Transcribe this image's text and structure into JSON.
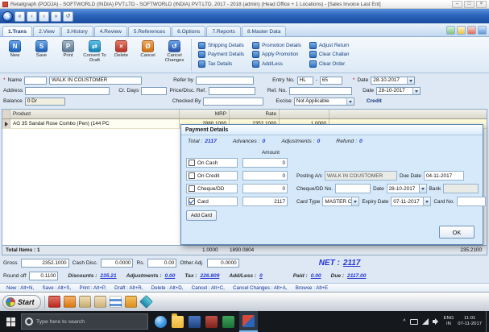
{
  "window": {
    "title": "Retailgraph (POOJA) - SOFTWORLD (INDIA) PVT.LTD - SOFTWORLD (INDIA) PVT.LTD.  2017 - 2018 (admin) (Head Office + 1 Locations) - [Sales Invoice   Last Ent]",
    "controls": {
      "minimize": "–",
      "maximize": "□",
      "close": "×"
    }
  },
  "toolbar": {
    "logo": "S",
    "nav": [
      "«",
      "‹",
      "›",
      "»",
      "↺"
    ]
  },
  "tabs": [
    "1.Trans",
    "2.View",
    "3.History",
    "4.Review",
    "5.References",
    "6.Options",
    "7.Reports",
    "8.Master Data"
  ],
  "ribbon": {
    "main": [
      {
        "glyph": "N",
        "label": "New"
      },
      {
        "glyph": "S",
        "label": "Save"
      },
      {
        "glyph": "P",
        "label": "Print"
      },
      {
        "glyph": "⇄",
        "label": "Convert To Draft"
      },
      {
        "glyph": "×",
        "label": "Delete"
      },
      {
        "glyph": "Ø",
        "label": "Cancel"
      },
      {
        "glyph": "↺",
        "label": "Cancel Changes"
      }
    ],
    "details": [
      "Shipping Details",
      "Payment Details",
      "Tax Details",
      "Promotion Details",
      "Apply Promotion",
      "Add/Less",
      "Adjust Return",
      "Clear Challan",
      "Clear Order"
    ]
  },
  "form": {
    "req_mark": "*",
    "name_label": "Name",
    "name_value": "WALK IN COUSTOMER",
    "refer_by_label": "Refer by",
    "entry_no_label": "Entry No.",
    "entry_prefix": "HL",
    "entry_sep": "-",
    "entry_number": "65",
    "date1_label": "Date",
    "date1_value": "28-10-2017",
    "address_label": "Address",
    "cr_days_label": "Cr. Days",
    "price_ref_label": "Price/Disc. Ref.",
    "ref_no_label": "Ref. No.",
    "date2_label": "Date",
    "date2_value": "28-10-2017",
    "balance_label": "Balance",
    "balance_value": "0 Dr",
    "checked_by_label": "Checked By",
    "excise_label": "Excise",
    "excise_value": "Not Applicable",
    "credit_label": "Credit"
  },
  "grid": {
    "columns": [
      "Product",
      "MRP",
      "Rate"
    ],
    "row": {
      "product": "AG 35 Sandal Rose Combo (Pen) (144 PC",
      "mrp": "2880.1000",
      "rate": "2352.1000",
      "qty": "1.0000"
    },
    "totals": {
      "label": "Total Items : 1",
      "qty": "1.0000",
      "amount": "1890.0804",
      "discount": "235.2100"
    }
  },
  "payment": {
    "title": "Payment Details",
    "totals": [
      {
        "label": "Total :",
        "value": "2117"
      },
      {
        "label": "Advances :",
        "value": "0"
      },
      {
        "label": "Adjustments :",
        "value": "0"
      },
      {
        "label": "Refund :",
        "value": "0"
      }
    ],
    "amount_header": "Amount",
    "cash": {
      "label": "On Cash",
      "amount": "0"
    },
    "credit": {
      "label": "On Credit",
      "amount": "0",
      "posting_label": "Posting A/c",
      "posting_value": "WALK IN COUSTOMER",
      "due_label": "Due Date",
      "due_value": "04-11-2017"
    },
    "cheque": {
      "label": "Cheque/DD",
      "amount": "0",
      "no_label": "Cheque/DD No.",
      "no_value": "",
      "date_label": "Date",
      "date_value": "28-10-2017",
      "bank_label": "Bank",
      "bank_value": ""
    },
    "card": {
      "label": "Card",
      "amount": "2117",
      "type_label": "Card Type",
      "type_value": "MASTER CAR",
      "expiry_label": "Expiry Date",
      "expiry_value": "07-11-2017",
      "no_label": "Card No.",
      "no_value": ""
    },
    "add_card": "Add Card",
    "ok": "OK"
  },
  "summary": {
    "gross_label": "Gross",
    "gross_value": "2352.1000",
    "cash_disc_label": "Cash Disc.",
    "cash_disc_value": "0.0000",
    "rs_label": "Rs.",
    "rs_value": "0.00",
    "other_adj_label": "Other Adj.",
    "other_adj_value": "0.0000",
    "net_label": "NET :",
    "net_value": "2117",
    "round_off_label": "Round off",
    "round_off_value": "0.1100",
    "discounts_label": "Discounts :",
    "discounts_value": "235.21",
    "adjustments_label": "Adjustments :",
    "adjustments_value": "0.00",
    "tax_label": "Tax :",
    "tax_value": "226.809",
    "addless_label": "Add/Less :",
    "addless_value": "0",
    "paid_label": "Paid :",
    "paid_value": "0.00",
    "due_label": "Due :",
    "due_value": "2117.00"
  },
  "status_text": "New : Alt+N,      Save : Alt+S,      Print : Alt+P,      Draft : Alt+R,      Delete : Alt+D,      Cancel : Alt+C,      Cancel Changes : Alt+A,      Browse : Alt+E",
  "quicklaunch": {
    "start": "Start"
  },
  "taskbar": {
    "search_placeholder": "Type here to search",
    "chevron": "^",
    "lang_top": "ENG",
    "lang_bottom": "IN",
    "time": "11:01",
    "date": "07-11-2017"
  }
}
